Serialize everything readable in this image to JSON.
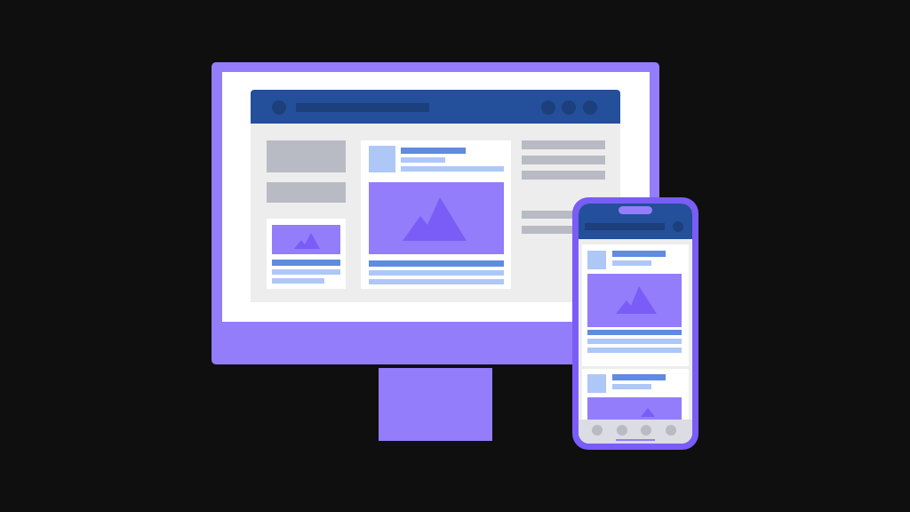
{
  "colors": {
    "background": "#0f0f0f",
    "purple": "#937dfa",
    "purple_dark": "#7a5cf6",
    "navy": "#234f9b",
    "navy_dark": "#1d3f7c",
    "screen_white": "#ffffff",
    "panel_gray": "#ededed",
    "placeholder_gray": "#b8bac4",
    "light_blue": "#adc8f7",
    "mid_blue": "#5f8be0"
  },
  "illustration": {
    "desktop": {
      "nav_dots": 3,
      "icons": [
        "image-placeholder-icon",
        "image-placeholder-icon"
      ]
    },
    "phone": {
      "bottom_nav_icons": 4,
      "icons": [
        "image-placeholder-icon",
        "image-placeholder-icon"
      ]
    }
  }
}
